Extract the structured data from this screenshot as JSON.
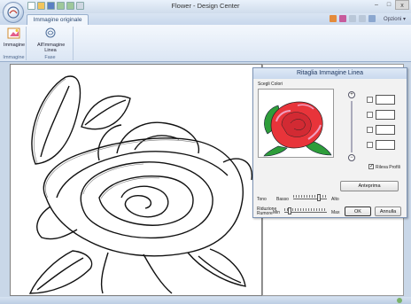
{
  "window": {
    "title": "Flower - Design Center",
    "close_label": "x",
    "minimize_label": "–",
    "maximize_label": "□"
  },
  "tabs": [
    {
      "label": "Immagine originale"
    }
  ],
  "menu": {
    "options_label": "Opzioni ▾"
  },
  "ribbon": {
    "groups": [
      {
        "label": "Immagine",
        "buttons": [
          {
            "label": "Immagine"
          }
        ]
      },
      {
        "label": "Fase",
        "buttons": [
          {
            "label": "All'Immagine Linea"
          }
        ]
      }
    ]
  },
  "dialog": {
    "title": "Ritaglia Immagine Linea",
    "colors_label": "Scegli Colori",
    "tone": {
      "label": "Tono",
      "min_label": "Basso",
      "max_label": "Alto",
      "level": 0.8
    },
    "noise": {
      "label": "Riduzione Rumore",
      "min_label": "Min",
      "max_label": "Max",
      "level": 0.1
    },
    "detect_profiles_label": "Rileva Profili",
    "detect_profiles_checked": true,
    "preview_button": "Anteprima",
    "ok_button": "OK",
    "cancel_button": "Annulla"
  },
  "colors": {
    "accent": "#2d4a72",
    "rose_red": "#e8343a",
    "rose_pink": "#f0a0c0",
    "leaf_green": "#2e9d3a"
  }
}
